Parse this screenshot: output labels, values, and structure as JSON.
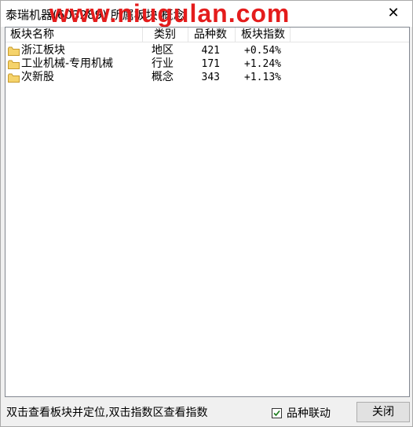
{
  "window": {
    "title": "泰瑞机器(603289) 所属板块 概念",
    "watermark": "www.niugulan.com",
    "close_glyph": "✕"
  },
  "table": {
    "headers": [
      "板块名称",
      "类别",
      "品种数",
      "板块指数"
    ],
    "rows": [
      {
        "name": "浙江板块",
        "category": "地区",
        "count": "421",
        "index": "+0.54%",
        "icon": "folder-icon"
      },
      {
        "name": "工业机械-专用机械",
        "category": "行业",
        "count": "171",
        "index": "+1.24%",
        "icon": "folder-icon"
      },
      {
        "name": "次新股",
        "category": "概念",
        "count": "343",
        "index": "+1.13%",
        "icon": "folder-icon"
      }
    ]
  },
  "footer": {
    "status_text": "双击查看板块并定位,双击指数区查看指数",
    "link_checkbox_label": "品种联动",
    "link_checkbox_checked": true,
    "close_button_label": "关闭"
  },
  "colors": {
    "watermark": "#e41c1c",
    "folder_fill": "#f5d36b",
    "folder_stroke": "#c79a2a",
    "check": "#1a7a1a"
  }
}
